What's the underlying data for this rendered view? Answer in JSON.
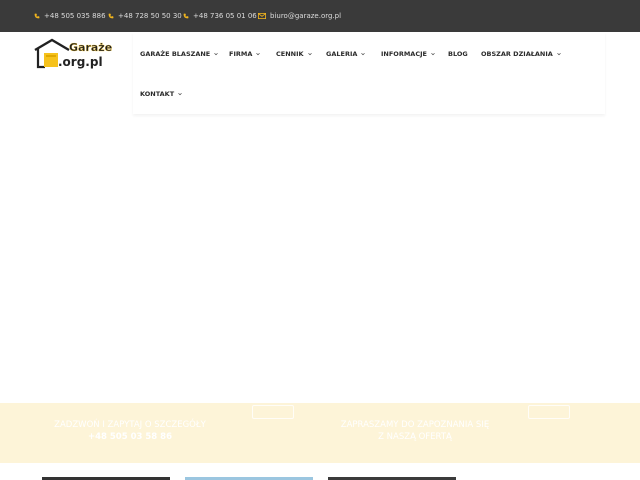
{
  "topbar": {
    "phones": [
      "+48 505 035 886",
      "+48 728 50 50 30",
      "+48 736 05 01 06"
    ],
    "email": "biuro@garaze.org.pl",
    "phone_icon": "phone-icon",
    "mail_icon": "envelope-icon",
    "icon_color": "#f2b51d"
  },
  "logo": {
    "line1": "Garaże",
    "line2": ".org.pl",
    "accent": "#f6c21c"
  },
  "nav": {
    "items": [
      {
        "label": "GARAŻE BLASZANE",
        "dropdown": true
      },
      {
        "label": "FIRMA",
        "dropdown": true
      },
      {
        "label": "CENNIK",
        "dropdown": true
      },
      {
        "label": "GALERIA",
        "dropdown": true
      },
      {
        "label": "INFORMACJE",
        "dropdown": true
      },
      {
        "label": "BLOG",
        "dropdown": false
      },
      {
        "label": "OBSZAR DZIAŁANIA",
        "dropdown": true
      },
      {
        "label": "KONTAKT",
        "dropdown": true
      }
    ]
  },
  "cta": {
    "left_line1": "ZADZWOŃ I ZAPYTAJ O SZCZEGÓŁY",
    "left_line2": "+48 505 03 58 86",
    "right_line1": "ZAPRASZAMY DO ZAPOZNANIA SIĘ",
    "right_line2": "Z NASZĄ OFERTĄ",
    "background": "#fdf4d8"
  }
}
